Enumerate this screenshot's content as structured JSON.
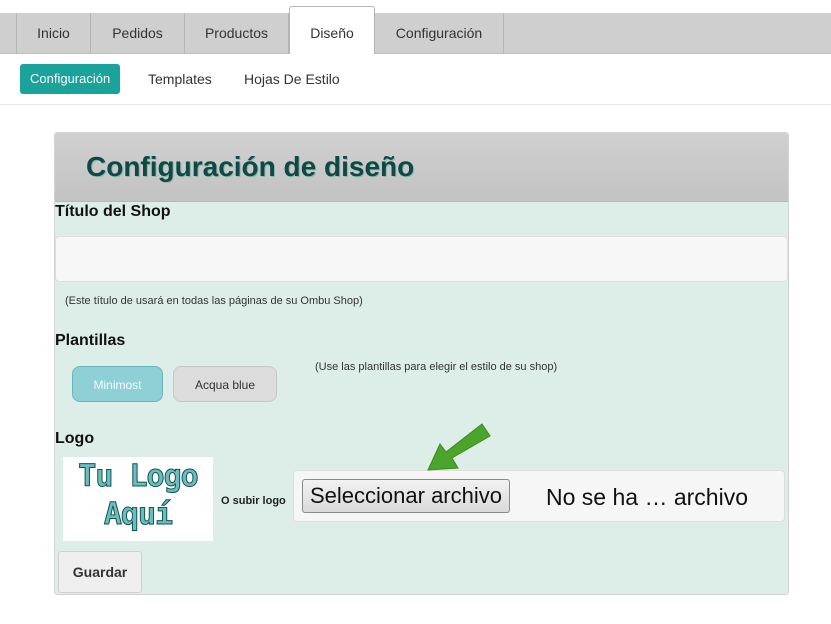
{
  "tabs": [
    {
      "label": "Inicio",
      "active": false
    },
    {
      "label": "Pedidos",
      "active": false
    },
    {
      "label": "Productos",
      "active": false
    },
    {
      "label": "Diseño",
      "active": true
    },
    {
      "label": "Configuración",
      "active": false
    }
  ],
  "subnav": [
    {
      "label": "Configuración",
      "active": true
    },
    {
      "label": "Templates",
      "active": false
    },
    {
      "label": "Hojas De Estilo",
      "active": false
    }
  ],
  "panel": {
    "title": "Configuración de diseño",
    "shop_title": {
      "label": "Título del Shop",
      "value": "",
      "hint": "(Este título de usará en todas las páginas de su Ombu Shop)"
    },
    "templates": {
      "label": "Plantillas",
      "options": [
        "Minimost",
        "Acqua blue"
      ],
      "selected": "Minimost",
      "hint": "(Use las plantillas para elegir el estilo de su shop)"
    },
    "logo": {
      "label": "Logo",
      "placeholder_line1": "Tu Logo",
      "placeholder_line2": "Aquí",
      "upload_label": "O subir logo",
      "file_button": "Seleccionar archivo",
      "file_status": "No se ha … archivo"
    },
    "save_label": "Guardar"
  },
  "colors": {
    "accent": "#1aa39a",
    "panel_bg": "#ddeee9",
    "title": "#0d4a45",
    "arrow": "#4aa52a"
  },
  "icons": {
    "arrow": "arrow-pointer-icon"
  }
}
